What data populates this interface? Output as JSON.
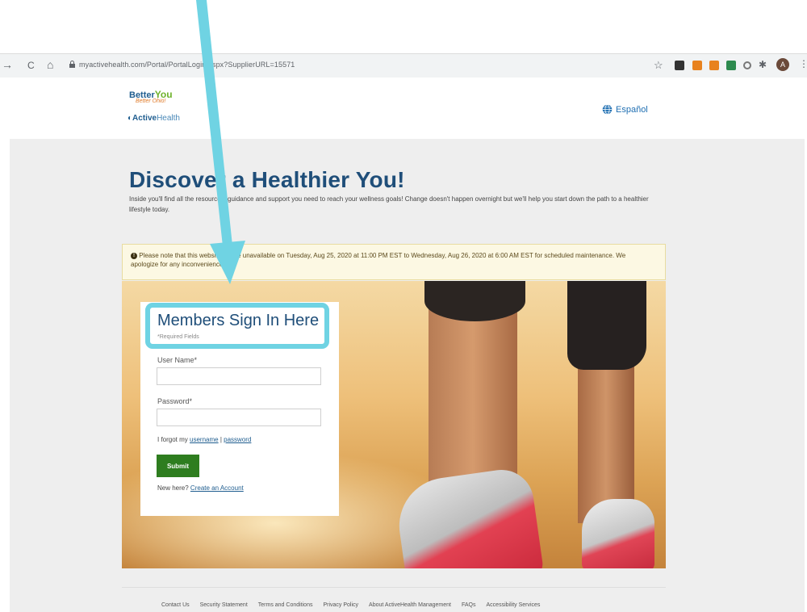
{
  "browser": {
    "url": "myactivehealth.com/Portal/PortalLogin.aspx?SupplierURL=15571",
    "back_glyph": "→",
    "reload_glyph": "C",
    "home_glyph": "⌂",
    "star_glyph": "☆",
    "profile_initial": "A",
    "menu_glyph": "⋮"
  },
  "header": {
    "logo_better": "Better",
    "logo_you": "You",
    "logo_tagline": "Better Ohio!",
    "logo_active": "Active",
    "logo_health": "Health",
    "language_link": "Español",
    "language_icon": "globe-icon"
  },
  "hero": {
    "headline": "Discover a Healthier You!",
    "intro": "Inside you'll find all the resources, guidance and support you need to reach your wellness goals! Change doesn't happen overnight but we'll help you start down the path to a healthier lifestyle today."
  },
  "notice": {
    "icon": "info-icon",
    "text": "Please note that this website will be unavailable on Tuesday, Aug 25, 2020 at 11:00 PM EST to Wednesday, Aug 26, 2020 at 6:00 AM EST for scheduled maintenance. We apologize for any inconvenience."
  },
  "signin": {
    "title": "Members Sign In Here",
    "required_hint": "*Required Fields",
    "username_label": "User Name*",
    "username_value": "",
    "password_label": "Password*",
    "password_value": "",
    "forgot_prefix": "I forgot my",
    "forgot_username": "username",
    "forgot_separator": "|",
    "forgot_password": "password",
    "submit_label": "Submit",
    "create_prefix": "New here?",
    "create_link": "Create an Account"
  },
  "footer": {
    "links": [
      "Contact Us",
      "Security Statement",
      "Terms and Conditions",
      "Privacy Policy",
      "About ActiveHealth Management",
      "FAQs",
      "Accessibility Services"
    ]
  },
  "colors": {
    "brand_blue": "#1f4e79",
    "submit_green": "#2e7d1f",
    "annotation_cyan": "#6fd3e3",
    "notice_bg": "#fcf8e3"
  }
}
